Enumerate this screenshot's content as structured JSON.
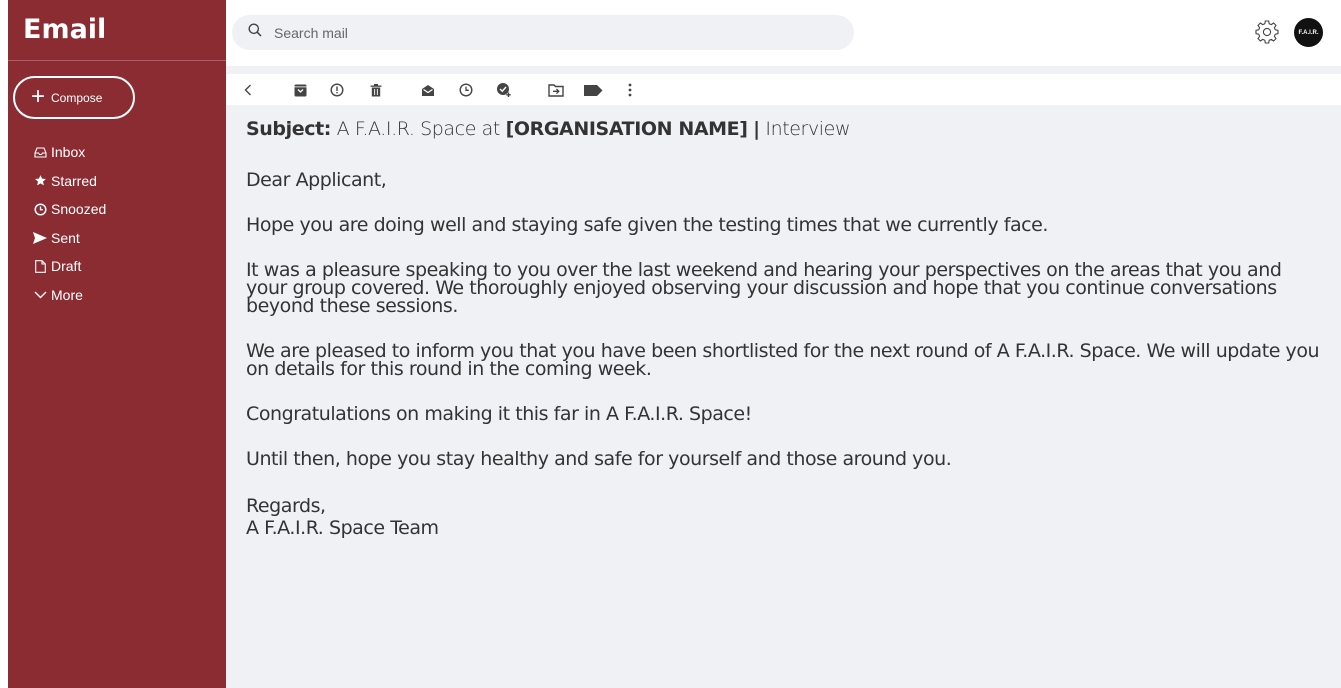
{
  "app": {
    "title": "Email"
  },
  "compose": {
    "label": "Compose"
  },
  "nav": {
    "items": [
      {
        "label": "Inbox",
        "icon": "inbox-icon"
      },
      {
        "label": "Starred",
        "icon": "star-icon"
      },
      {
        "label": "Snoozed",
        "icon": "clock-icon"
      },
      {
        "label": "Sent",
        "icon": "send-icon"
      },
      {
        "label": "Draft",
        "icon": "file-icon"
      },
      {
        "label": "More",
        "icon": "chevron-down-icon"
      }
    ]
  },
  "search": {
    "placeholder": "Search mail"
  },
  "avatar": {
    "text": "F.A.I.R."
  },
  "toolbar": {
    "icons": [
      "back-icon",
      "archive-icon",
      "report-spam-icon",
      "delete-icon",
      "mark-unread-icon",
      "snooze-icon",
      "add-task-icon",
      "move-to-icon",
      "label-icon",
      "more-vert-icon"
    ]
  },
  "message": {
    "subject_label": "Subject:",
    "subject_part1": "A F.A.I.R. Space at",
    "subject_org": "[ORGANISATION NAME]",
    "subject_sep": "|",
    "subject_part2": "Interview",
    "greeting": "Dear Applicant,",
    "p1": "Hope you are doing well and staying safe given the testing times that we currently face.",
    "p2": "It was a pleasure speaking to you over the last weekend and hearing your perspectives on the areas that you and your group covered. We thoroughly enjoyed observing your discussion and hope that you continue conversations beyond these sessions.",
    "p3": "We are pleased to inform you that you have been shortlisted for the next round of A F.A.I.R. Space. We will update you on details for this round in the coming week.",
    "p4": "Congratulations on making it this far in A F.A.I.R. Space!",
    "p5": "Until then, hope you stay healthy and safe for yourself and those around you.",
    "closing": "Regards,",
    "signature": "A F.A.I.R. Space Team"
  },
  "colors": {
    "sidebar": "#8b2c33",
    "background": "#f0f1f4"
  }
}
